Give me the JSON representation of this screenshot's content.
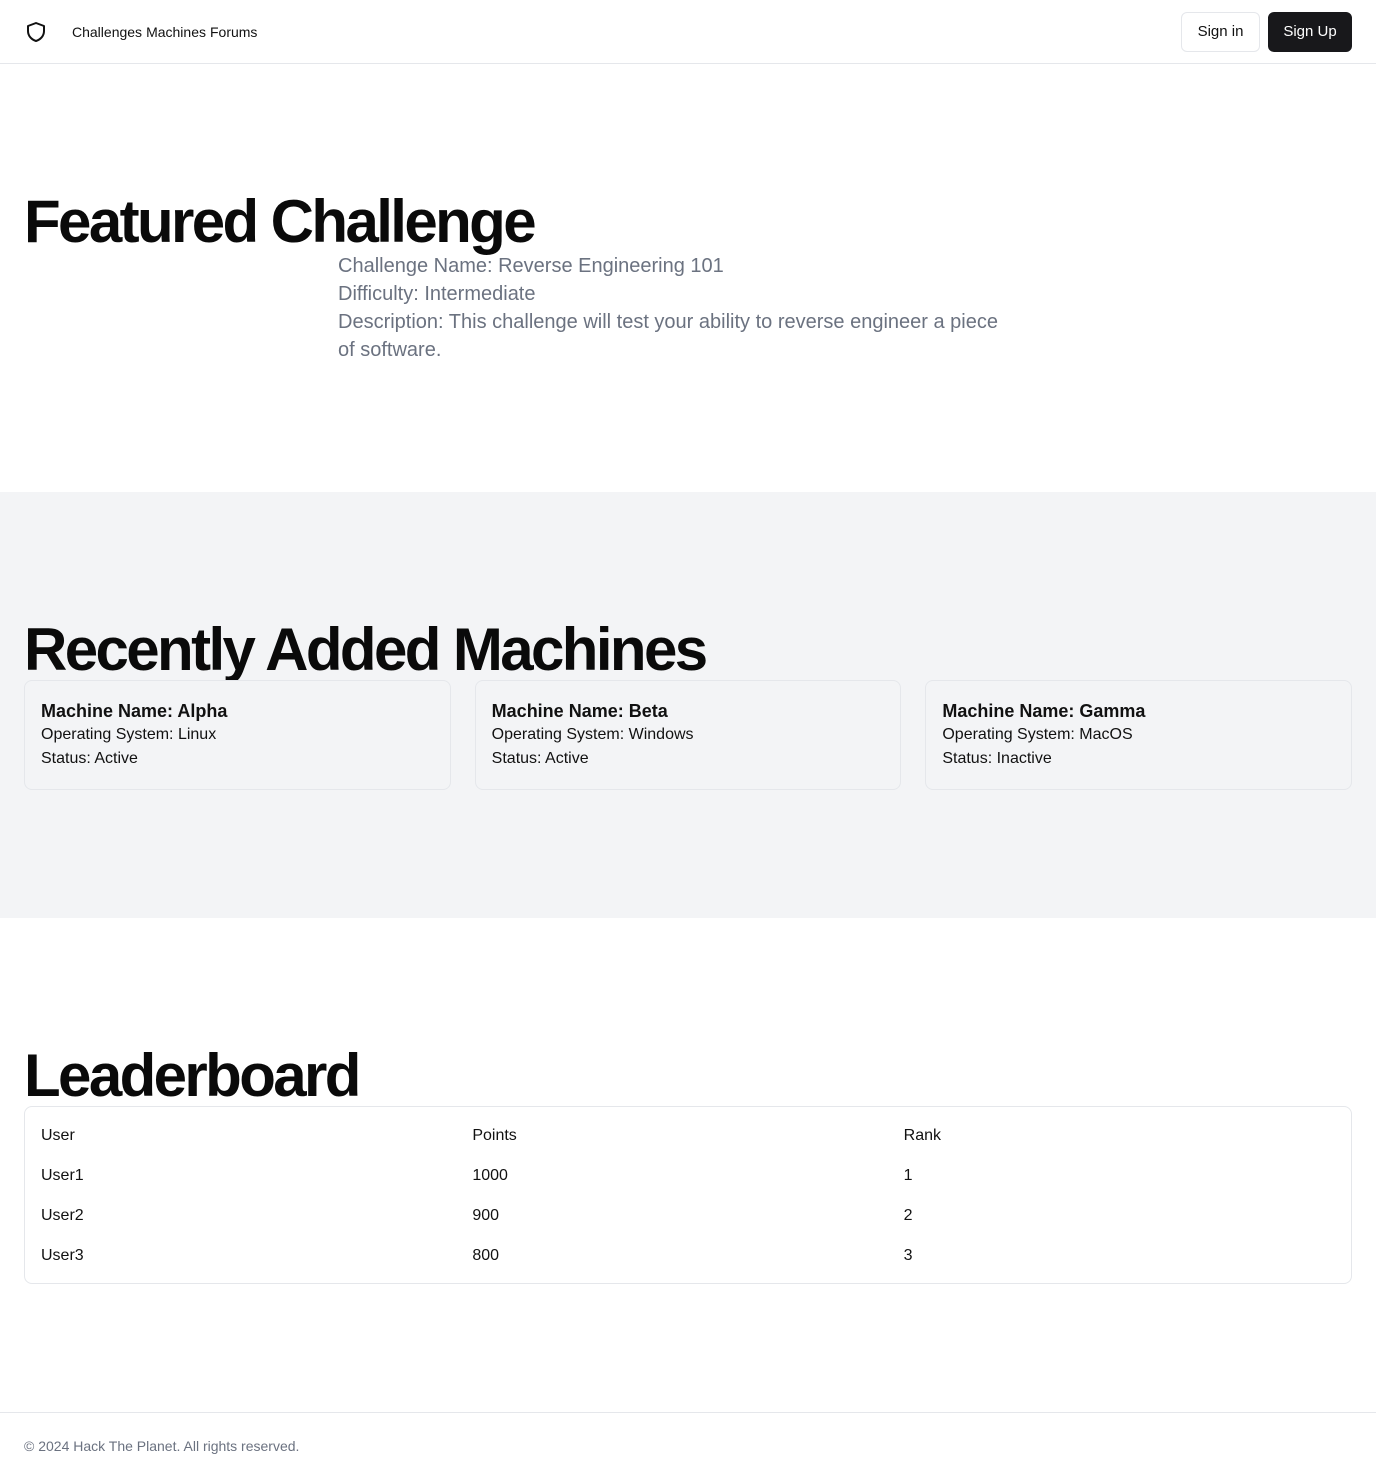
{
  "header": {
    "logo_icon": "shield-icon",
    "nav": [
      {
        "label": "Challenges"
      },
      {
        "label": "Machines"
      },
      {
        "label": "Forums"
      }
    ],
    "signin_label": "Sign in",
    "signup_label": "Sign Up"
  },
  "featured": {
    "heading": "Featured Challenge",
    "name_line": "Challenge Name: Reverse Engineering 101",
    "difficulty_line": "Difficulty: Intermediate",
    "description_line": "Description: This challenge will test your ability to reverse engineer a piece of software."
  },
  "machines": {
    "heading": "Recently Added Machines",
    "items": [
      {
        "name": "Machine Name: Alpha",
        "os": "Operating System: Linux",
        "status": "Status: Active"
      },
      {
        "name": "Machine Name: Beta",
        "os": "Operating System: Windows",
        "status": "Status: Active"
      },
      {
        "name": "Machine Name: Gamma",
        "os": "Operating System: MacOS",
        "status": "Status: Inactive"
      }
    ]
  },
  "leaderboard": {
    "heading": "Leaderboard",
    "columns": [
      "User",
      "Points",
      "Rank"
    ],
    "rows": [
      [
        "User1",
        "1000",
        "1"
      ],
      [
        "User2",
        "900",
        "2"
      ],
      [
        "User3",
        "800",
        "3"
      ]
    ]
  },
  "footer": {
    "text": "© 2024 Hack The Planet. All rights reserved."
  },
  "colors": {
    "primary_button": "#18181b",
    "muted_text": "#6b7280",
    "section_bg": "#f3f4f6",
    "border": "#e5e7eb"
  }
}
